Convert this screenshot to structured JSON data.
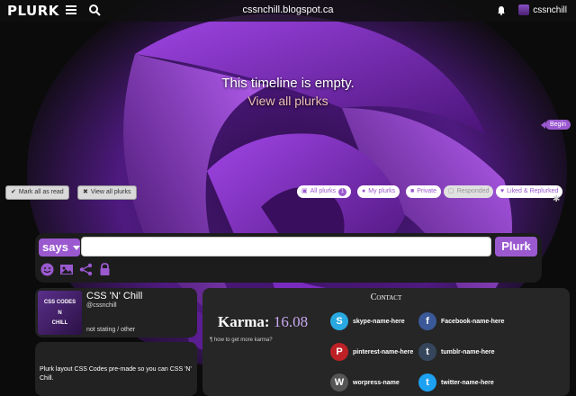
{
  "app": {
    "logo": "PLURK",
    "site_title": "cssnchill.blogspot.ca",
    "username": "cssnchill"
  },
  "timeline": {
    "empty_message": "This timeline is empty.",
    "view_all_link": "View all plurks",
    "begin_label": "Begin"
  },
  "actions": {
    "mark_all_read": "Mark all as read",
    "view_all": "View all plurks"
  },
  "filters": {
    "all": "All plurks",
    "all_count": "1",
    "my": "My plurks",
    "private": "Private",
    "responded": "Responded",
    "liked": "Liked & Replurked"
  },
  "compose": {
    "qualifier": "says",
    "input_value": "",
    "submit": "Plurk"
  },
  "profile": {
    "avatar_line1": "CSS CODES",
    "avatar_line2": "N",
    "avatar_line3": "CHILL",
    "name": "CSS 'N' Chill",
    "handle": "@cssnchill",
    "status": "not stating / other"
  },
  "about": {
    "text": "Plurk layout CSS Codes pre-made so you can CSS 'N' Chill."
  },
  "contact": {
    "title": "Contact",
    "karma_label": "Karma:",
    "karma_value": "16.08",
    "karma_help": "how to get more karma?",
    "items": [
      {
        "label": "skype-name-here",
        "icon": "S",
        "color": "#29a9e1"
      },
      {
        "label": "Facebook-name-here",
        "icon": "f",
        "color": "#3b5998"
      },
      {
        "label": "pinterest-name-here",
        "icon": "P",
        "color": "#bd2126"
      },
      {
        "label": "tumblr-name-here",
        "icon": "t",
        "color": "#35465c"
      },
      {
        "label": "worpress-name",
        "icon": "W",
        "color": "#555555"
      },
      {
        "label": "twitter-name-here",
        "icon": "t",
        "color": "#1da1f2"
      }
    ]
  },
  "colors": {
    "accent": "#9b59d0"
  }
}
